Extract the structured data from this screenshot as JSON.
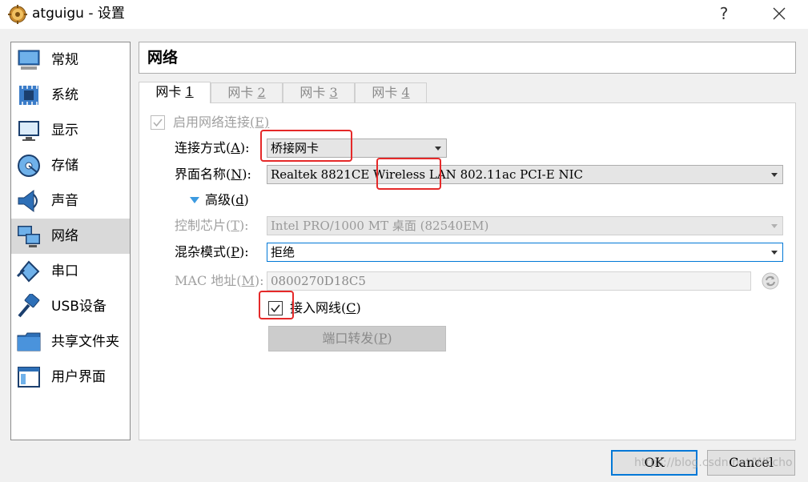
{
  "window": {
    "title": "atguigu - 设置",
    "help_label": "?"
  },
  "sidebar": {
    "items": [
      {
        "label": "常规",
        "icon": "monitor-icon"
      },
      {
        "label": "系统",
        "icon": "chip-icon"
      },
      {
        "label": "显示",
        "icon": "display-icon"
      },
      {
        "label": "存储",
        "icon": "disk-icon"
      },
      {
        "label": "声音",
        "icon": "speaker-icon"
      },
      {
        "label": "网络",
        "icon": "network-icon",
        "selected": true
      },
      {
        "label": "串口",
        "icon": "serial-port-icon"
      },
      {
        "label": "USB设备",
        "icon": "usb-icon"
      },
      {
        "label": "共享文件夹",
        "icon": "folder-icon"
      },
      {
        "label": "用户界面",
        "icon": "ui-window-icon"
      }
    ]
  },
  "main": {
    "section_title": "网络",
    "tabs": [
      {
        "prefix": "网卡 ",
        "num": "1",
        "active": true
      },
      {
        "prefix": "网卡 ",
        "num": "2"
      },
      {
        "prefix": "网卡 ",
        "num": "3"
      },
      {
        "prefix": "网卡 ",
        "num": "4"
      }
    ],
    "enable": {
      "label": "启用网络连接",
      "key": "(E)",
      "checked": true,
      "disabled": true
    },
    "attached": {
      "label": "连接方式",
      "key": "A",
      "value": "桥接网卡"
    },
    "interface": {
      "label": "界面名称",
      "key": "N",
      "value": "Realtek 8821CE Wireless LAN 802.11ac PCI-E NIC"
    },
    "advanced": {
      "label": "高级",
      "key": "d"
    },
    "adapter": {
      "label": "控制芯片",
      "key": "T",
      "value": "Intel PRO/1000 MT 桌面 (82540EM)"
    },
    "promisc": {
      "label": "混杂模式",
      "key": "P",
      "value": "拒绝"
    },
    "mac": {
      "label": "MAC 地址",
      "key": "M",
      "value": "0800270D18C5"
    },
    "cable": {
      "label": "接入网线",
      "key": "C",
      "checked": true
    },
    "port_forward": {
      "label": "端口转发",
      "key": "P"
    }
  },
  "footer": {
    "ok_label": "OK",
    "cancel_label": "Cancel",
    "watermark": "https://blog.csdn.net/WEcho"
  },
  "colors": {
    "highlight_box": "#e52929",
    "focus_border": "#0078d7",
    "selected_row": "#d9d9d9"
  }
}
